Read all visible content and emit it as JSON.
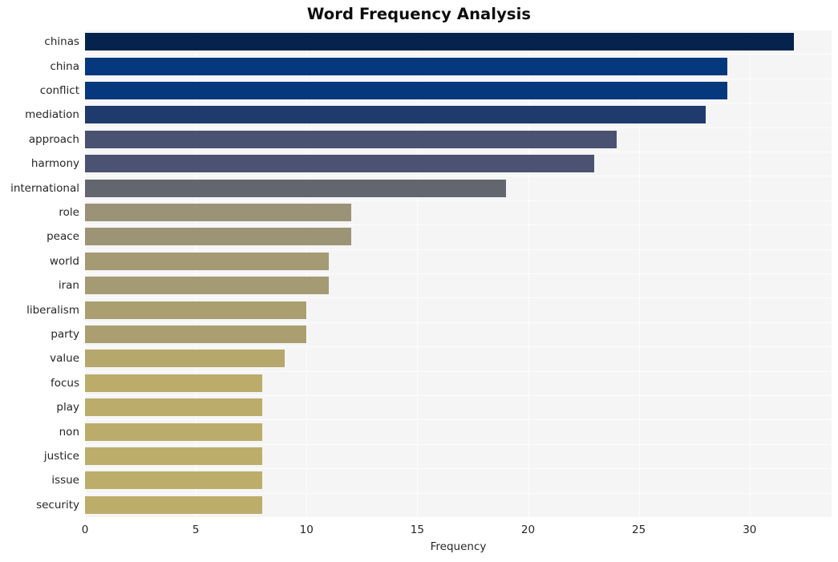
{
  "chart_data": {
    "type": "bar",
    "orientation": "horizontal",
    "title": "Word Frequency Analysis",
    "xlabel": "Frequency",
    "ylabel": "",
    "categories": [
      "chinas",
      "china",
      "conflict",
      "mediation",
      "approach",
      "harmony",
      "international",
      "role",
      "peace",
      "world",
      "iran",
      "liberalism",
      "party",
      "value",
      "focus",
      "play",
      "non",
      "justice",
      "issue",
      "security"
    ],
    "values": [
      32,
      29,
      29,
      28,
      24,
      23,
      19,
      12,
      12,
      11,
      11,
      10,
      10,
      9,
      8,
      8,
      8,
      8,
      8,
      8
    ],
    "bar_colors": [
      "#05234c",
      "#05387c",
      "#05387c",
      "#1f3a6d",
      "#4a5272",
      "#4c5372",
      "#63666f",
      "#9a9377",
      "#9d9475",
      "#a49a73",
      "#a49a73",
      "#ab9f71",
      "#ab9f71",
      "#b6a76d",
      "#bcac6b",
      "#bcac6b",
      "#bcac6b",
      "#bdad6b",
      "#bdad6b",
      "#bdad6b"
    ],
    "xticks": [
      0,
      5,
      10,
      15,
      20,
      25,
      30
    ],
    "xlim": [
      0,
      33.7
    ],
    "grid": true,
    "gridline_color": "#fdfdfd",
    "plot_background": "#f5f5f6",
    "figure_background": "#ffffff",
    "legend": null
  },
  "axes": {
    "x_tick_labels": [
      "0",
      "5",
      "10",
      "15",
      "20",
      "25",
      "30"
    ],
    "y_tick_labels": [
      "chinas",
      "china",
      "conflict",
      "mediation",
      "approach",
      "harmony",
      "international",
      "role",
      "peace",
      "world",
      "iran",
      "liberalism",
      "party",
      "value",
      "focus",
      "play",
      "non",
      "justice",
      "issue",
      "security"
    ]
  }
}
